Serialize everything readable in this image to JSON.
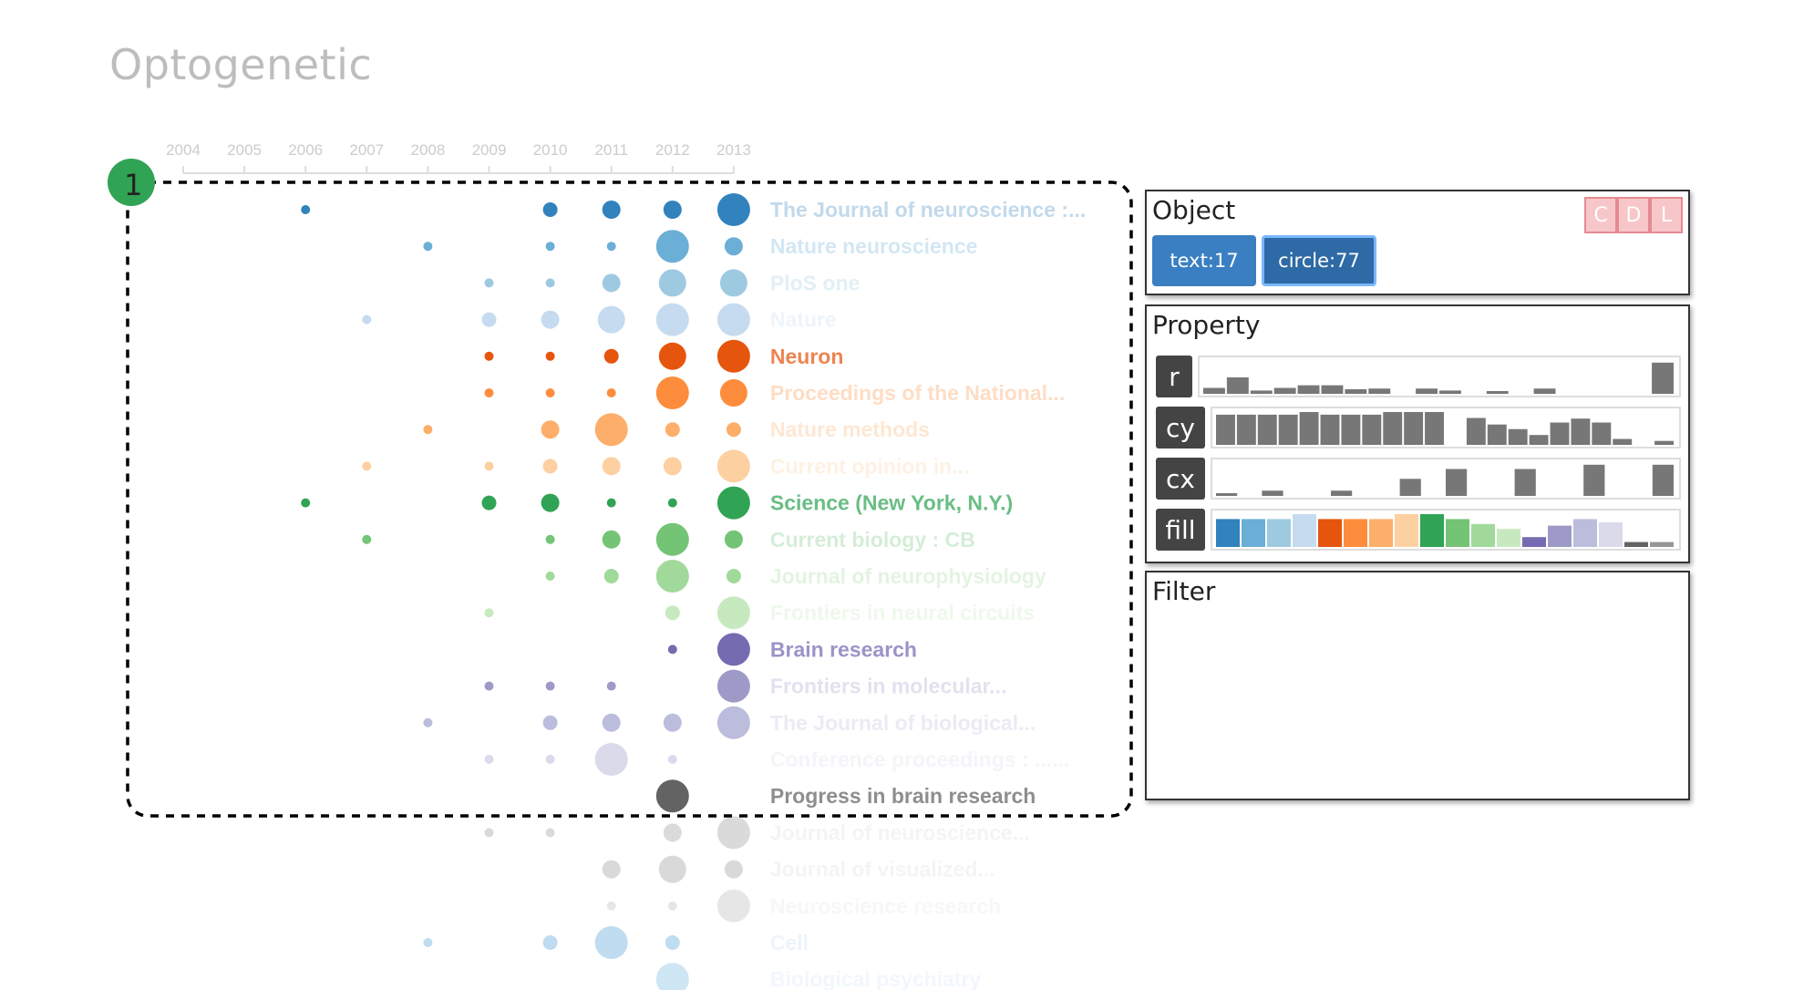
{
  "page": {
    "title": "Optogenetic"
  },
  "overlay": {
    "badge_label": "1"
  },
  "chart_data": {
    "type": "scatter",
    "title": "",
    "xlabel": "",
    "ylabel": "",
    "x_ticks": [
      "2004",
      "2005",
      "2006",
      "2007",
      "2008",
      "2009",
      "2010",
      "2011",
      "2012",
      "2013"
    ],
    "series": [
      {
        "journal": "The Journal of neuroscience :...",
        "color": "#3182bd",
        "points": [
          {
            "year": 2006,
            "size": 1
          },
          {
            "year": 2010,
            "size": 2
          },
          {
            "year": 2011,
            "size": 3
          },
          {
            "year": 2012,
            "size": 3
          },
          {
            "year": 2013,
            "size": 5
          }
        ]
      },
      {
        "journal": "Nature neuroscience",
        "color": "#6baed6",
        "points": [
          {
            "year": 2008,
            "size": 1
          },
          {
            "year": 2010,
            "size": 1
          },
          {
            "year": 2011,
            "size": 1
          },
          {
            "year": 2012,
            "size": 5
          },
          {
            "year": 2013,
            "size": 3
          }
        ]
      },
      {
        "journal": "PloS one",
        "color": "#9ecae1",
        "points": [
          {
            "year": 2009,
            "size": 1
          },
          {
            "year": 2010,
            "size": 1
          },
          {
            "year": 2011,
            "size": 3
          },
          {
            "year": 2012,
            "size": 4
          },
          {
            "year": 2013,
            "size": 4
          }
        ]
      },
      {
        "journal": "Nature",
        "color": "#c6dbef",
        "points": [
          {
            "year": 2007,
            "size": 1
          },
          {
            "year": 2009,
            "size": 2
          },
          {
            "year": 2010,
            "size": 3
          },
          {
            "year": 2011,
            "size": 4
          },
          {
            "year": 2012,
            "size": 5
          },
          {
            "year": 2013,
            "size": 5
          }
        ]
      },
      {
        "journal": "Neuron",
        "color": "#e6550d",
        "points": [
          {
            "year": 2009,
            "size": 1
          },
          {
            "year": 2010,
            "size": 1
          },
          {
            "year": 2011,
            "size": 2
          },
          {
            "year": 2012,
            "size": 4
          },
          {
            "year": 2013,
            "size": 5
          }
        ]
      },
      {
        "journal": "Proceedings of the National...",
        "color": "#fd8d3c",
        "points": [
          {
            "year": 2009,
            "size": 1
          },
          {
            "year": 2010,
            "size": 1
          },
          {
            "year": 2011,
            "size": 1
          },
          {
            "year": 2012,
            "size": 5
          },
          {
            "year": 2013,
            "size": 4
          }
        ]
      },
      {
        "journal": "Nature methods",
        "color": "#fdae6b",
        "points": [
          {
            "year": 2008,
            "size": 1
          },
          {
            "year": 2010,
            "size": 3
          },
          {
            "year": 2011,
            "size": 5
          },
          {
            "year": 2012,
            "size": 2
          },
          {
            "year": 2013,
            "size": 2
          }
        ]
      },
      {
        "journal": "Current opinion in...",
        "color": "#fdd0a2",
        "points": [
          {
            "year": 2007,
            "size": 1
          },
          {
            "year": 2009,
            "size": 1
          },
          {
            "year": 2010,
            "size": 2
          },
          {
            "year": 2011,
            "size": 3
          },
          {
            "year": 2012,
            "size": 3
          },
          {
            "year": 2013,
            "size": 5
          }
        ]
      },
      {
        "journal": "Science (New York, N.Y.)",
        "color": "#31a354",
        "points": [
          {
            "year": 2006,
            "size": 1
          },
          {
            "year": 2009,
            "size": 2
          },
          {
            "year": 2010,
            "size": 3
          },
          {
            "year": 2011,
            "size": 1
          },
          {
            "year": 2012,
            "size": 1
          },
          {
            "year": 2013,
            "size": 5
          }
        ]
      },
      {
        "journal": "Current biology : CB",
        "color": "#74c476",
        "points": [
          {
            "year": 2007,
            "size": 1
          },
          {
            "year": 2010,
            "size": 1
          },
          {
            "year": 2011,
            "size": 3
          },
          {
            "year": 2012,
            "size": 5
          },
          {
            "year": 2013,
            "size": 3
          }
        ]
      },
      {
        "journal": "Journal of neurophysiology",
        "color": "#a1d99b",
        "points": [
          {
            "year": 2010,
            "size": 1
          },
          {
            "year": 2011,
            "size": 2
          },
          {
            "year": 2012,
            "size": 5
          },
          {
            "year": 2013,
            "size": 2
          }
        ]
      },
      {
        "journal": "Frontiers in neural circuits",
        "color": "#c7e9c0",
        "points": [
          {
            "year": 2009,
            "size": 1
          },
          {
            "year": 2012,
            "size": 2
          },
          {
            "year": 2013,
            "size": 5
          }
        ]
      },
      {
        "journal": "Brain research",
        "color": "#756bb1",
        "points": [
          {
            "year": 2012,
            "size": 1
          },
          {
            "year": 2013,
            "size": 5
          }
        ]
      },
      {
        "journal": "Frontiers in molecular...",
        "color": "#9e9ac8",
        "points": [
          {
            "year": 2009,
            "size": 1
          },
          {
            "year": 2010,
            "size": 1
          },
          {
            "year": 2011,
            "size": 1
          },
          {
            "year": 2013,
            "size": 5
          }
        ]
      },
      {
        "journal": "The Journal of biological...",
        "color": "#bcbddc",
        "points": [
          {
            "year": 2008,
            "size": 1
          },
          {
            "year": 2010,
            "size": 2
          },
          {
            "year": 2011,
            "size": 3
          },
          {
            "year": 2012,
            "size": 3
          },
          {
            "year": 2013,
            "size": 5
          }
        ]
      },
      {
        "journal": "Conference proceedings : ......",
        "color": "#dadaeb",
        "points": [
          {
            "year": 2009,
            "size": 1
          },
          {
            "year": 2010,
            "size": 1
          },
          {
            "year": 2011,
            "size": 5
          },
          {
            "year": 2012,
            "size": 1
          }
        ]
      },
      {
        "journal": "Progress in brain research",
        "color": "#636363",
        "points": [
          {
            "year": 2012,
            "size": 5
          }
        ]
      },
      {
        "journal": "Journal of neuroscience...",
        "color": "#dadada",
        "points": [
          {
            "year": 2009,
            "size": 1
          },
          {
            "year": 2010,
            "size": 1
          },
          {
            "year": 2012,
            "size": 3
          },
          {
            "year": 2013,
            "size": 5
          }
        ]
      },
      {
        "journal": "Journal of visualized...",
        "color": "#d9d9d9",
        "points": [
          {
            "year": 2011,
            "size": 3
          },
          {
            "year": 2012,
            "size": 4
          },
          {
            "year": 2013,
            "size": 3
          }
        ]
      },
      {
        "journal": "Neuroscience research",
        "color": "#e6e6e6",
        "points": [
          {
            "year": 2011,
            "size": 1
          },
          {
            "year": 2012,
            "size": 1
          },
          {
            "year": 2013,
            "size": 5
          }
        ]
      },
      {
        "journal": "Cell",
        "color": "#bfdcf0",
        "points": [
          {
            "year": 2008,
            "size": 1
          },
          {
            "year": 2010,
            "size": 2
          },
          {
            "year": 2011,
            "size": 5
          },
          {
            "year": 2012,
            "size": 2
          }
        ]
      },
      {
        "journal": "Biological psychiatry",
        "color": "#cfe6f5",
        "points": [
          {
            "year": 2012,
            "size": 5
          }
        ]
      }
    ],
    "highlighted": [
      "Neuron",
      "Science (New York, N.Y.)",
      "Brain research",
      "Progress in brain research"
    ]
  },
  "object_panel": {
    "title": "Object",
    "buttons": [
      {
        "label": "text:17"
      },
      {
        "label": "circle:77"
      }
    ],
    "cdl": [
      "C",
      "D",
      "L"
    ]
  },
  "property_panel": {
    "title": "Property",
    "rows": [
      {
        "label": "r",
        "bars": [
          0.18,
          0.5,
          0.1,
          0.18,
          0.26,
          0.26,
          0.14,
          0.16,
          0,
          0.16,
          0.1,
          0,
          0.06,
          0,
          0.16,
          0,
          0,
          0,
          0,
          0.95
        ],
        "colors": []
      },
      {
        "label": "cy",
        "bars": [
          0.92,
          0.92,
          0.92,
          0.92,
          1,
          0.92,
          0.92,
          0.92,
          1,
          1,
          1,
          0,
          0.82,
          0.62,
          0.48,
          0.3,
          0.68,
          0.8,
          0.68,
          0.18,
          0,
          0.12
        ],
        "colors": []
      },
      {
        "label": "cx",
        "bars": [
          0.08,
          0,
          0.16,
          0,
          0,
          0.16,
          0,
          0,
          0.52,
          0,
          0.82,
          0,
          0,
          0.82,
          0,
          0,
          0.95,
          0,
          0,
          0.95
        ],
        "colors": []
      },
      {
        "label": "fill",
        "bars": [
          0.85,
          0.85,
          0.85,
          1,
          0.85,
          0.85,
          0.85,
          1,
          1,
          0.85,
          0.7,
          0.55,
          0.3,
          0.65,
          0.85,
          0.75,
          0.15,
          0.15
        ],
        "colors": [
          "#3182bd",
          "#6baed6",
          "#9ecae1",
          "#c6dbef",
          "#e6550d",
          "#fd8d3c",
          "#fdae6b",
          "#fdd0a2",
          "#31a354",
          "#74c476",
          "#a1d99b",
          "#c7e9c0",
          "#756bb1",
          "#9e9ac8",
          "#bcbddc",
          "#dadaeb",
          "#636363",
          "#969696"
        ]
      }
    ]
  },
  "filter_panel": {
    "title": "Filter"
  }
}
